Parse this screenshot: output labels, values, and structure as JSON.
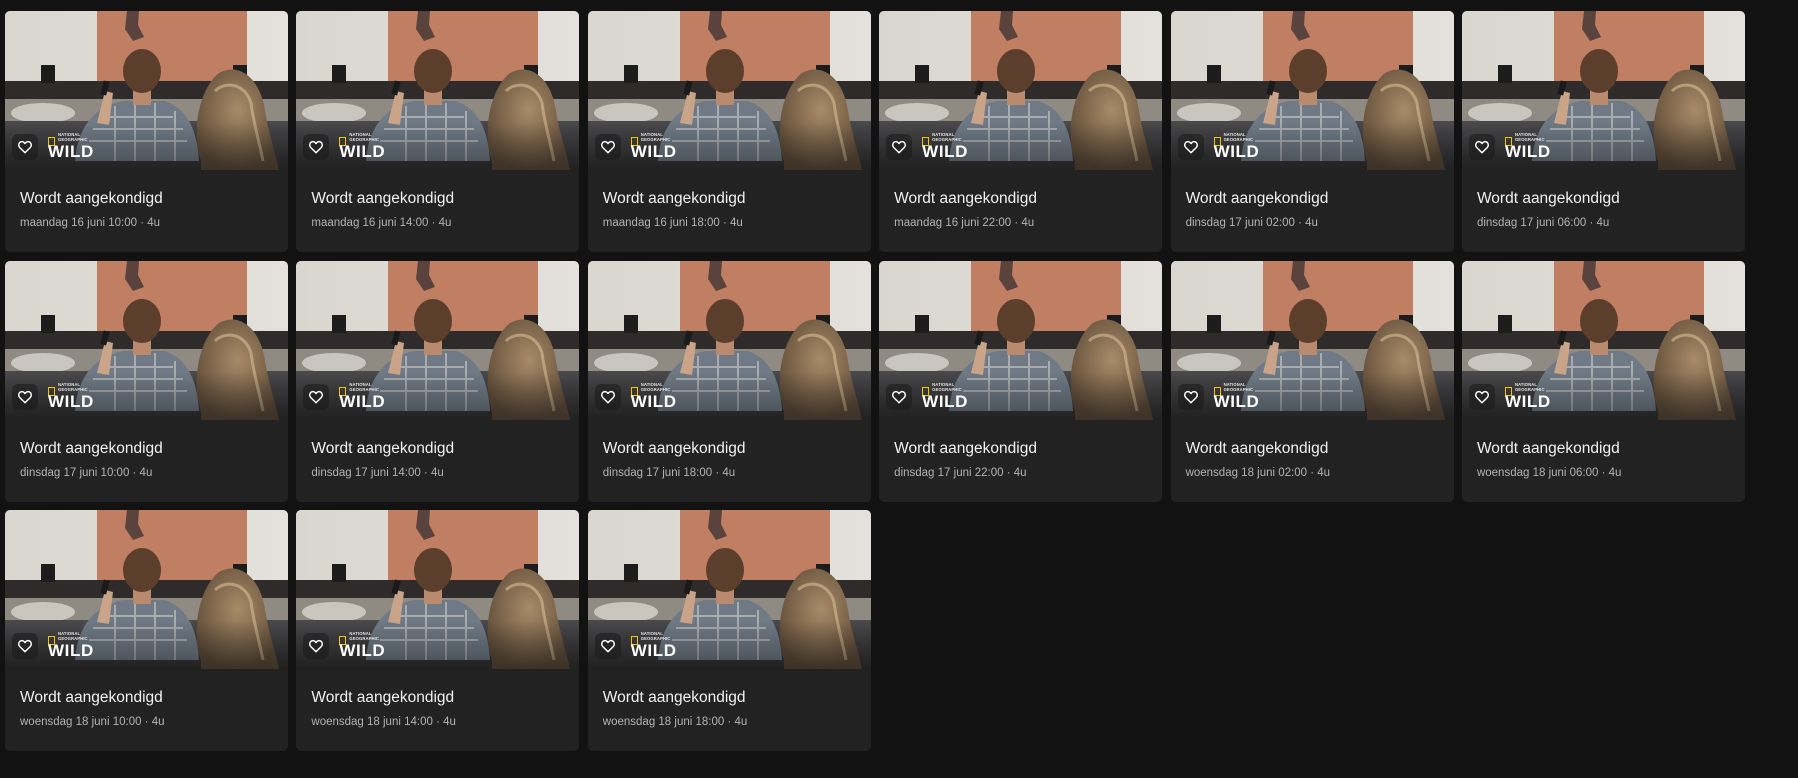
{
  "card_template": {
    "title": "Wordt aangekondigd",
    "brand_top": "NATIONAL\nGEOGRAPHIC",
    "brand_main": "WILD",
    "fav_icon": "heart-outline-icon",
    "brand_box_color": "#f5c400"
  },
  "cards": [
    {
      "title": "Wordt aangekondigd",
      "meta": "maandag 16 juni 10:00 · 4u"
    },
    {
      "title": "Wordt aangekondigd",
      "meta": "maandag 16 juni 14:00 · 4u"
    },
    {
      "title": "Wordt aangekondigd",
      "meta": "maandag 16 juni 18:00 · 4u"
    },
    {
      "title": "Wordt aangekondigd",
      "meta": "maandag 16 juni 22:00 · 4u"
    },
    {
      "title": "Wordt aangekondigd",
      "meta": "dinsdag 17 juni 02:00 · 4u"
    },
    {
      "title": "Wordt aangekondigd",
      "meta": "dinsdag 17 juni 06:00 · 4u"
    },
    {
      "title": "Wordt aangekondigd",
      "meta": "dinsdag 17 juni 10:00 · 4u"
    },
    {
      "title": "Wordt aangekondigd",
      "meta": "dinsdag 17 juni 14:00 · 4u"
    },
    {
      "title": "Wordt aangekondigd",
      "meta": "dinsdag 17 juni 18:00 · 4u"
    },
    {
      "title": "Wordt aangekondigd",
      "meta": "dinsdag 17 juni 22:00 · 4u"
    },
    {
      "title": "Wordt aangekondigd",
      "meta": "woensdag 18 juni 02:00 · 4u"
    },
    {
      "title": "Wordt aangekondigd",
      "meta": "woensdag 18 juni 06:00 · 4u"
    },
    {
      "title": "Wordt aangekondigd",
      "meta": "woensdag 18 juni 10:00 · 4u"
    },
    {
      "title": "Wordt aangekondigd",
      "meta": "woensdag 18 juni 14:00 · 4u"
    },
    {
      "title": "Wordt aangekondigd",
      "meta": "woensdag 18 juni 18:00 · 4u"
    }
  ]
}
